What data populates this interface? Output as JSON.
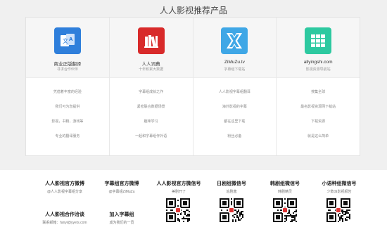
{
  "page_title": "人人影视推荐产品",
  "products": [
    {
      "name": "商业正版翻译",
      "subtitle": "寻求合作伙伴",
      "icon": "translate-icon",
      "color": "#2f7fdb",
      "features": [
        "凭借着丰富的经验",
        "我们可为您提供",
        "影视，书籍，游戏等",
        "专业的翻译服务"
      ]
    },
    {
      "name": "人人词典",
      "subtitle": "十年积累大数据",
      "icon": "dictionary-books-icon",
      "color": "#d82a2a",
      "features": [
        "字幕组成就之作",
        "紧密联合数据场景",
        "趣味学习",
        "一起和字幕组作外语"
      ]
    },
    {
      "name": "ZiMuZu.tv",
      "subtitle": "字幕组下载站",
      "icon": "zimuzu-x-icon",
      "color": "#3fa7e6",
      "features": [
        "人人影视字幕组翻译",
        "海外影视的字幕",
        "都在这里下载",
        "粉丝必备"
      ]
    },
    {
      "name": "allyingshi.com",
      "subtitle": "影视资源导航站",
      "icon": "grid-apps-icon",
      "color": "#2dc9a0",
      "features": [
        "搜集全球",
        "最名影视资源网下载站",
        "下载资源",
        "就是这么简单"
      ]
    }
  ],
  "accounts": [
    {
      "title": "人人影视官方微博",
      "sub": "@人人影视字幕组分享"
    },
    {
      "title": "字幕组官方微博",
      "sub": "@字幕组ZiMuZu"
    },
    {
      "title": "人人影视合作洽谈",
      "sub": "联系邮箱：fanyi@yyets.com"
    },
    {
      "title": "加入字幕组",
      "sub": "成为我们的一员"
    }
  ],
  "wechat": [
    {
      "title": "人人影视官方微信号",
      "sub": "美剧开了"
    },
    {
      "title": "日剧组微信号",
      "sub": "追剧酱"
    },
    {
      "title": "韩剧组微信号",
      "sub": "韩剧精灵"
    },
    {
      "title": "小语种组微信号",
      "sub": "少数派影视报告"
    }
  ]
}
